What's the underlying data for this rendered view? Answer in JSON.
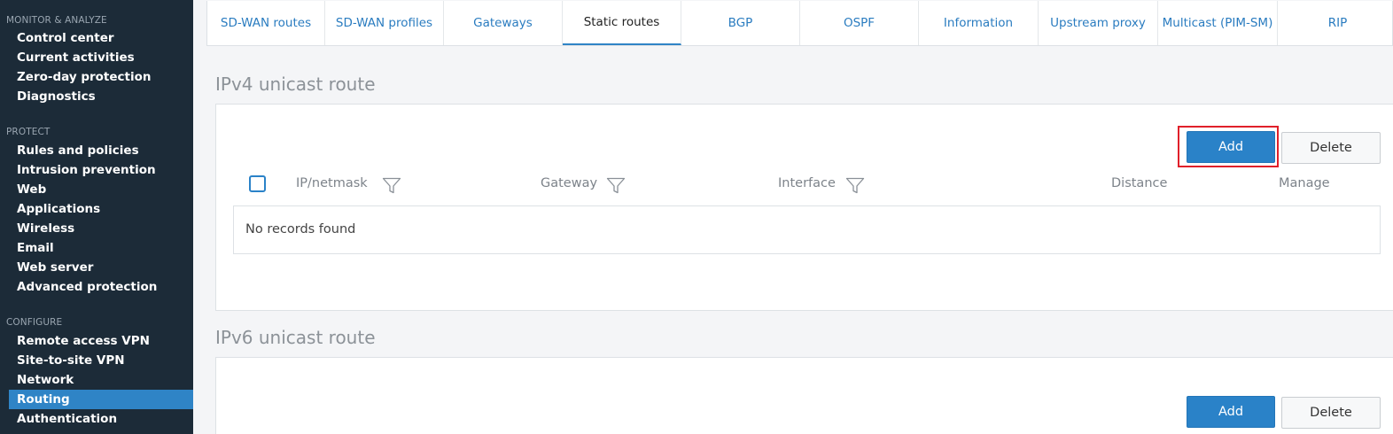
{
  "sidebar": {
    "sections": [
      {
        "title": "MONITOR & ANALYZE",
        "items": [
          "Control center",
          "Current activities",
          "Zero-day protection",
          "Diagnostics"
        ]
      },
      {
        "title": "PROTECT",
        "items": [
          "Rules and policies",
          "Intrusion prevention",
          "Web",
          "Applications",
          "Wireless",
          "Email",
          "Web server",
          "Advanced protection"
        ]
      },
      {
        "title": "CONFIGURE",
        "items": [
          "Remote access VPN",
          "Site-to-site VPN",
          "Network",
          "Routing",
          "Authentication"
        ]
      }
    ],
    "active_item": "Routing"
  },
  "tabs": [
    "SD-WAN routes",
    "SD-WAN profiles",
    "Gateways",
    "Static routes",
    "BGP",
    "OSPF",
    "Information",
    "Upstream proxy",
    "Multicast (PIM-SM)",
    "RIP"
  ],
  "active_tab": "Static routes",
  "ipv4": {
    "heading": "IPv4 unicast route",
    "add_label": "Add",
    "delete_label": "Delete",
    "columns": {
      "ip_netmask": "IP/netmask",
      "gateway": "Gateway",
      "interface": "Interface",
      "distance": "Distance",
      "manage": "Manage"
    },
    "empty_text": "No records found"
  },
  "ipv6": {
    "heading": "IPv6 unicast route",
    "add_label": "Add",
    "delete_label": "Delete"
  },
  "colors": {
    "sidebar_bg": "#1c2b38",
    "accent": "#2a82c8",
    "highlight": "#e0202a"
  }
}
